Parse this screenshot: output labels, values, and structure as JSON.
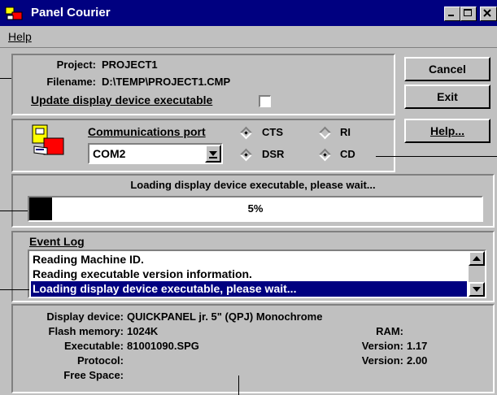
{
  "window": {
    "title": "Panel Courier"
  },
  "menu": {
    "help": "Help"
  },
  "project": {
    "project_label": "Project:",
    "project_value": "PROJECT1",
    "filename_label": "Filename:",
    "filename_value": "D:\\TEMP\\PROJECT1.CMP",
    "update_label": "Update display device executable",
    "update_checked": false
  },
  "buttons": {
    "cancel": "Cancel",
    "exit": "Exit",
    "help": "Help..."
  },
  "comm": {
    "label": "Communications port",
    "port": "COM2",
    "signals": [
      {
        "name": "CTS",
        "active": true
      },
      {
        "name": "RI",
        "active": false
      },
      {
        "name": "DSR",
        "active": true
      },
      {
        "name": "CD",
        "active": true
      }
    ]
  },
  "progress": {
    "message": "Loading display device executable, please wait...",
    "percent_text": "5%",
    "fraction": 0.05
  },
  "event_log": {
    "label": "Event Log",
    "items": [
      "Reading Machine ID.",
      "Reading executable version information.",
      "Loading display device executable, please wait..."
    ],
    "selected_index": 2
  },
  "device": {
    "display_device_label": "Display device:",
    "display_device_value": "QUICKPANEL jr. 5\" (QPJ) Monochrome",
    "flash_label": "Flash memory:",
    "flash_value": "1024K",
    "executable_label": "Executable:",
    "executable_value": "81001090.SPG",
    "protocol_label": "Protocol:",
    "free_space_label": "Free Space:",
    "ram_label": "RAM:",
    "version1_label": "Version:",
    "version1_value": "1.17",
    "version2_label": "Version:",
    "version2_value": "2.00"
  },
  "colors": {
    "face": "#c0c0c0",
    "title": "#000080",
    "highlight": "#000080"
  }
}
